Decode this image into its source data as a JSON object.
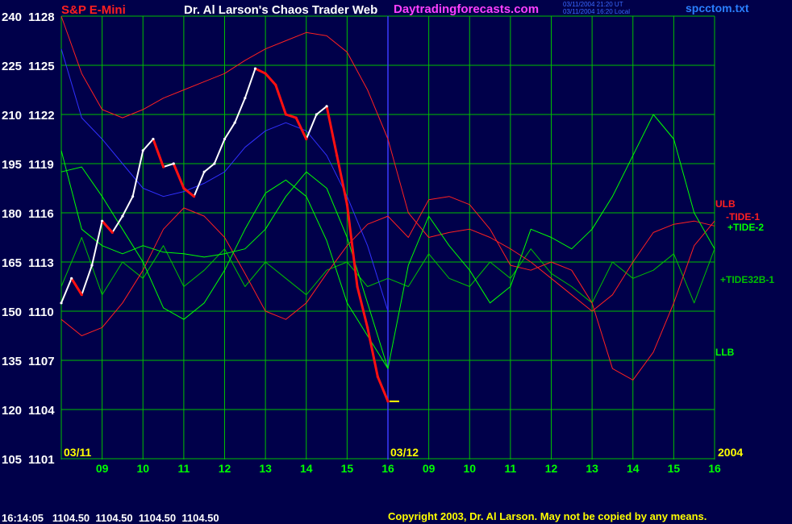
{
  "header": {
    "symbol": "S&P E-Mini",
    "title": "Dr. Al Larson's Chaos Trader Web",
    "site": "Daytradingforecasts.com",
    "timestamp_ut": "03/11/2004 21:20 UT",
    "timestamp_local": "03/11/2004 16:20 Local",
    "filename": "spcctom.txt"
  },
  "footer": {
    "quote": "16:14:05   1104.50  1104.50  1104.50  1104.50",
    "copyright": "Copyright 2003, Dr. Al Larson. May not be copied by any means."
  },
  "colors": {
    "background": "#00004a",
    "grid": "#00c000",
    "divider": "#3a3aff",
    "price": "#ffffff",
    "price_down": "#ff1010",
    "ulb": "#ff2020",
    "llb": "#00ff00",
    "tide1": "#ff2020",
    "tide2": "#00ff00",
    "tide32b": "#00c000",
    "ma": "#3030ff",
    "label_left": "#ffffff",
    "date_labels": "#ffff00",
    "hour_labels": "#00ff00",
    "site": "#ff40ff",
    "filename": "#2a7fff"
  },
  "chart_data": {
    "type": "line",
    "y_left_ticks": [
      "240",
      "225",
      "210",
      "195",
      "180",
      "165",
      "150",
      "135",
      "120",
      "105"
    ],
    "y_right_ticks": [
      "1128",
      "1125",
      "1122",
      "1119",
      "1116",
      "1113",
      "1110",
      "1107",
      "1104",
      "1101"
    ],
    "ylim": [
      1101,
      1128
    ],
    "x_hour_labels": [
      "09",
      "10",
      "11",
      "12",
      "13",
      "14",
      "15",
      "16",
      "09",
      "10",
      "11",
      "12",
      "13",
      "14",
      "15",
      "16"
    ],
    "date_labels": [
      "03/11",
      "03/12"
    ],
    "year_label": "2004",
    "series_labels": {
      "ulb": "ULB",
      "tide1": "-TIDE-1",
      "tide2": "+TIDE-2",
      "tide32b": "+TIDE32B-1",
      "llb": "LLB"
    },
    "last_price": 1104.5,
    "series": [
      {
        "name": "price",
        "x": [
          8.0,
          8.25,
          8.5,
          8.75,
          9.0,
          9.25,
          9.5,
          9.75,
          10.0,
          10.25,
          10.5,
          10.75,
          11.0,
          11.25,
          11.5,
          11.75,
          12.0,
          12.25,
          12.5,
          12.75,
          13.0,
          13.25,
          13.5,
          13.75,
          14.0,
          14.25,
          14.5,
          14.75,
          15.0,
          15.25,
          15.5,
          15.75,
          16.0
        ],
        "values": [
          1110.5,
          1112.0,
          1111.0,
          1112.8,
          1115.5,
          1114.8,
          1115.8,
          1117.0,
          1119.8,
          1120.5,
          1118.8,
          1119.0,
          1117.5,
          1117.0,
          1118.5,
          1119.0,
          1120.5,
          1121.5,
          1123.0,
          1124.8,
          1124.5,
          1123.8,
          1122.0,
          1121.8,
          1120.5,
          1122.0,
          1122.5,
          1119.5,
          1116.5,
          1111.5,
          1109.0,
          1106.0,
          1104.5
        ]
      },
      {
        "name": "ULB",
        "x": [
          8.0,
          8.5,
          9.0,
          9.5,
          10.0,
          10.5,
          11.0,
          11.5,
          12.0,
          12.5,
          13.0,
          13.5,
          14.0,
          14.5,
          15.0,
          15.5,
          16.0,
          16.5,
          17.0,
          17.5,
          18.0,
          18.5,
          19.0,
          19.5,
          20.0,
          20.5,
          21.0,
          21.5,
          22.0,
          22.5,
          23.0,
          23.5,
          24.0
        ],
        "values": [
          1128.0,
          1124.5,
          1122.3,
          1121.8,
          1122.3,
          1123.0,
          1123.5,
          1124.0,
          1124.5,
          1125.3,
          1126.0,
          1126.5,
          1127.0,
          1126.8,
          1125.8,
          1123.5,
          1120.5,
          1116.0,
          1114.5,
          1114.8,
          1115.0,
          1114.5,
          1113.8,
          1113.0,
          1112.0,
          1111.0,
          1110.0,
          1111.0,
          1113.0,
          1114.8,
          1115.3,
          1115.5,
          1115.2
        ]
      },
      {
        "name": "LLB",
        "x": [
          8.0,
          8.5,
          9.0,
          9.5,
          10.0,
          10.5,
          11.0,
          11.5,
          12.0,
          12.5,
          13.0,
          13.5,
          14.0,
          14.5,
          15.0,
          15.5,
          16.0
        ],
        "values": [
          1119.8,
          1115.0,
          1114.0,
          1113.5,
          1114.0,
          1113.6,
          1113.5,
          1113.3,
          1113.5,
          1113.8,
          1115.0,
          1117.0,
          1118.5,
          1117.5,
          1114.5,
          1110.5,
          1106.5
        ]
      },
      {
        "name": "-TIDE-1",
        "x": [
          8.0,
          8.5,
          9.0,
          9.5,
          10.0,
          10.5,
          11.0,
          11.5,
          12.0,
          12.5,
          13.0,
          13.5,
          14.0,
          14.5,
          15.0,
          15.5,
          16.0,
          16.5,
          17.0,
          17.5,
          18.0,
          18.5,
          19.0,
          19.5,
          20.0,
          20.5,
          21.0,
          21.5,
          22.0,
          22.5,
          23.0,
          23.5,
          24.0
        ],
        "values": [
          1109.5,
          1108.5,
          1109.0,
          1110.5,
          1112.5,
          1115.0,
          1116.3,
          1115.8,
          1114.5,
          1112.3,
          1110.0,
          1109.5,
          1110.5,
          1112.3,
          1114.0,
          1115.3,
          1115.8,
          1114.5,
          1116.8,
          1117.0,
          1116.5,
          1115.0,
          1112.8,
          1112.5,
          1113.0,
          1112.5,
          1110.5,
          1106.5,
          1105.8,
          1107.5,
          1110.5,
          1114.0,
          1115.5
        ]
      },
      {
        "name": "+TIDE-2",
        "x": [
          8.0,
          8.5,
          9.0,
          9.5,
          10.0,
          10.5,
          11.0,
          11.5,
          12.0,
          12.5,
          13.0,
          13.5,
          14.0,
          14.5,
          15.0,
          15.5,
          16.0,
          16.5,
          17.0,
          17.5,
          18.0,
          18.5,
          19.0,
          19.5,
          20.0,
          20.5,
          21.0,
          21.5,
          22.0,
          22.5,
          23.0,
          23.5,
          24.0
        ],
        "values": [
          1118.5,
          1118.8,
          1117.0,
          1115.0,
          1113.0,
          1110.2,
          1109.5,
          1110.5,
          1112.5,
          1115.0,
          1117.2,
          1118.0,
          1117.0,
          1114.3,
          1110.5,
          1108.5,
          1106.5,
          1112.8,
          1115.8,
          1114.0,
          1112.5,
          1110.5,
          1111.5,
          1115.0,
          1114.5,
          1113.8,
          1115.0,
          1117.0,
          1119.5,
          1122.0,
          1120.5,
          1116.0,
          1113.8
        ]
      },
      {
        "name": "+TIDE32B-1",
        "x": [
          8.0,
          8.5,
          9.0,
          9.5,
          10.0,
          10.5,
          11.0,
          11.5,
          12.0,
          12.5,
          13.0,
          13.5,
          14.0,
          14.5,
          15.0,
          15.5,
          16.0,
          16.5,
          17.0,
          17.5,
          18.0,
          18.5,
          19.0,
          19.5,
          20.0,
          20.5,
          21.0,
          21.5,
          22.0,
          22.5,
          23.0,
          23.5,
          24.0
        ],
        "values": [
          1111.5,
          1114.5,
          1111.0,
          1113.0,
          1112.0,
          1114.0,
          1111.5,
          1112.5,
          1113.8,
          1111.5,
          1113.0,
          1112.0,
          1111.0,
          1112.5,
          1113.0,
          1111.5,
          1112.0,
          1111.5,
          1113.5,
          1112.0,
          1111.5,
          1113.0,
          1112.0,
          1113.8,
          1112.3,
          1111.5,
          1110.5,
          1113.0,
          1112.0,
          1112.5,
          1113.5,
          1110.5,
          1113.8
        ]
      },
      {
        "name": "moving-average",
        "x": [
          8.0,
          8.5,
          9.0,
          9.5,
          10.0,
          10.5,
          11.0,
          11.5,
          12.0,
          12.5,
          13.0,
          13.5,
          14.0,
          14.5,
          15.0,
          15.5,
          16.0
        ],
        "values": [
          1126.0,
          1121.8,
          1120.5,
          1119.0,
          1117.5,
          1117.0,
          1117.3,
          1117.8,
          1118.5,
          1120.0,
          1121.0,
          1121.5,
          1121.0,
          1119.5,
          1117.0,
          1114.0,
          1110.0
        ]
      }
    ]
  }
}
